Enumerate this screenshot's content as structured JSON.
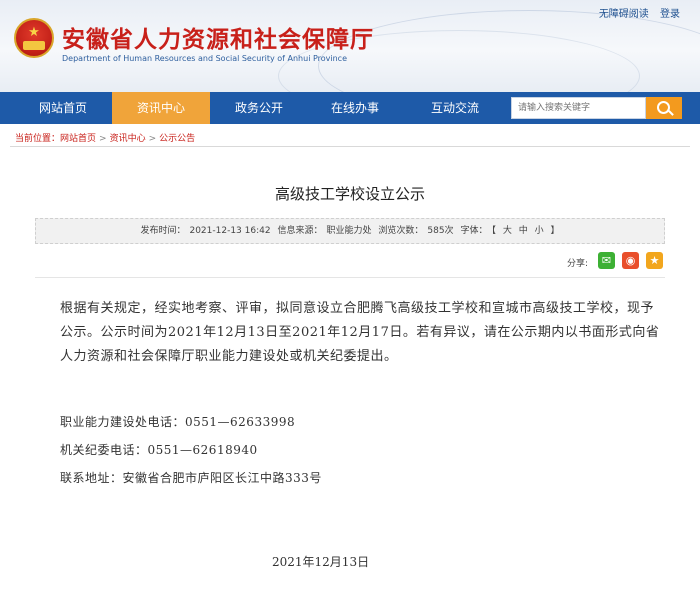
{
  "header": {
    "site_title": "安徽省人力资源和社会保障厅",
    "site_subtitle": "Department of Human Resources and Social Security of Anhui Province",
    "links": [
      "无障碍阅读",
      "登录"
    ]
  },
  "nav": {
    "items": [
      "网站首页",
      "资讯中心",
      "政务公开",
      "在线办事",
      "互动交流"
    ],
    "active": "资讯中心",
    "search_placeholder": "请输入搜索关键字"
  },
  "breadcrumb": {
    "label": "当前位置：",
    "items": [
      "网站首页",
      "资讯中心",
      "公示公告"
    ],
    "separator": ">"
  },
  "article": {
    "title": "高级技工学校设立公示",
    "meta": {
      "publish_label": "发布时间：",
      "publish_time": "2021-12-13 16:42",
      "source_label": "信息来源：",
      "source": "职业能力处",
      "views_label": "浏览次数：",
      "views": "585次",
      "font_label": "字体：",
      "font_open": "【",
      "font_sizes": [
        "大",
        "中",
        "小"
      ],
      "font_close": "】"
    },
    "share_label": "分享:",
    "body": "根据有关规定，经实地考察、评审，拟同意设立合肥腾飞高级技工学校和宣城市高级技工学校，现予公示。公示时间为2021年12月13日至2021年12月17日。若有异议，请在公示期内以书面形式向省人力资源和社会保障厅职业能力建设处或机关纪委提出。",
    "contacts": [
      "职业能力建设处电话：0551—62633998",
      "机关纪委电话：0551—62618940",
      "联系地址：安徽省合肥市庐阳区长江中路333号"
    ],
    "date": "2021年12月13日"
  }
}
